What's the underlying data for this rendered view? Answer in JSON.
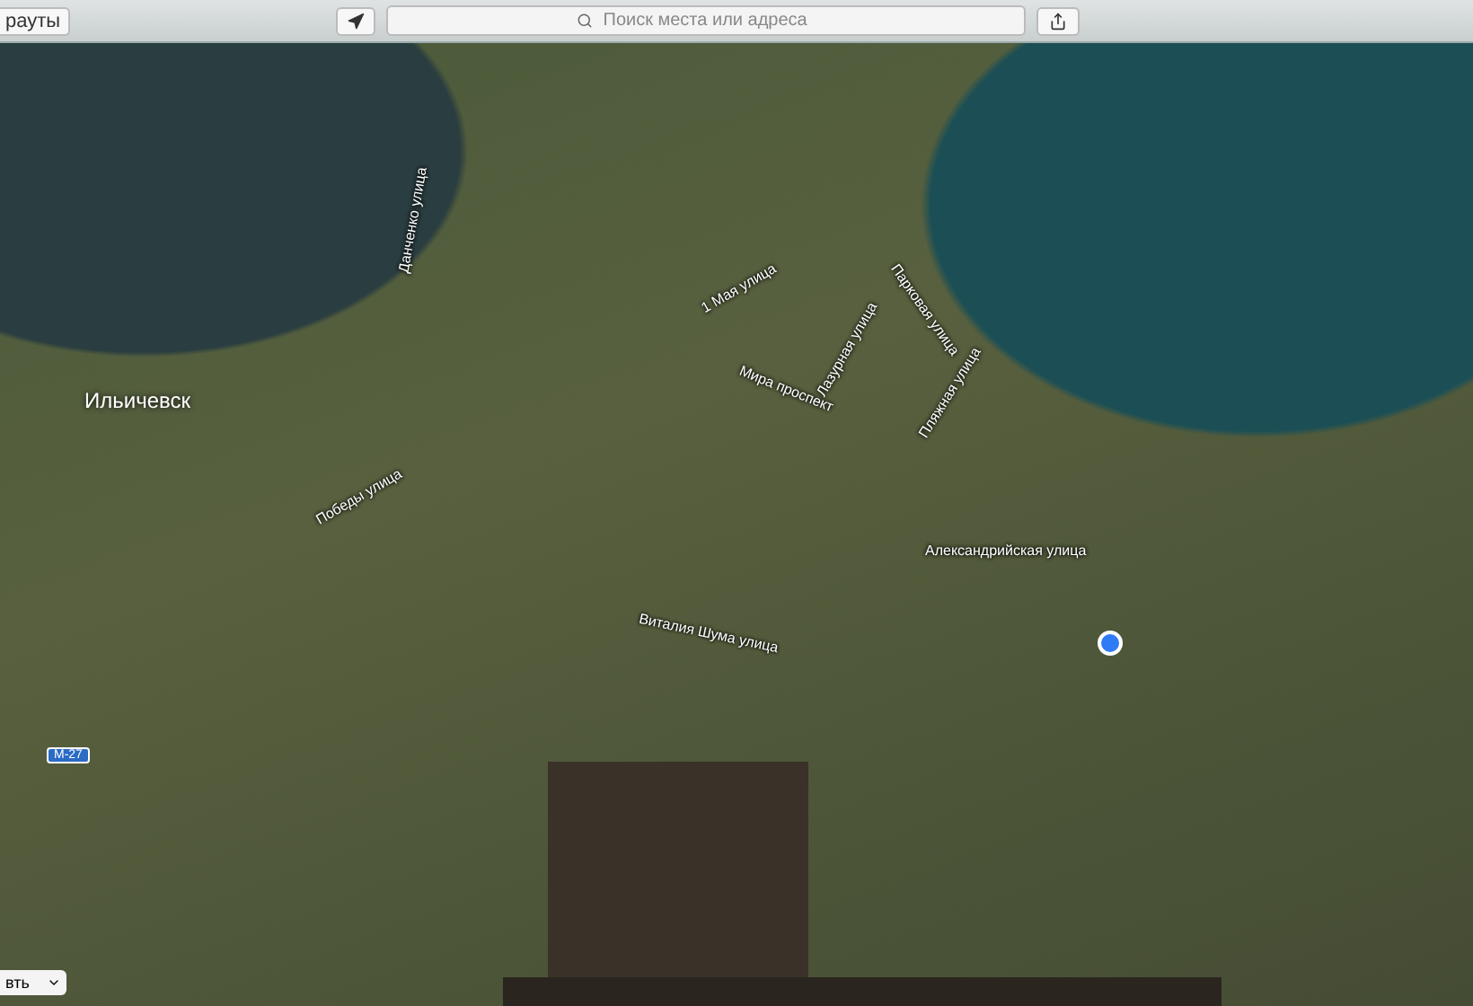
{
  "toolbar": {
    "routes_button": "рауты",
    "search": {
      "placeholder": "Поиск места или адреса"
    }
  },
  "map": {
    "city_label": "Ильичевск",
    "road_badge": "M-27",
    "street_labels": [
      "Данченко улица",
      "1 Мая улица",
      "Лазурная улица",
      "Парковая улица",
      "Мира проспект",
      "Пляжная улица",
      "Победы улица",
      "Александрийская улица",
      "Виталия Шума улица"
    ]
  },
  "view_select": "вть"
}
